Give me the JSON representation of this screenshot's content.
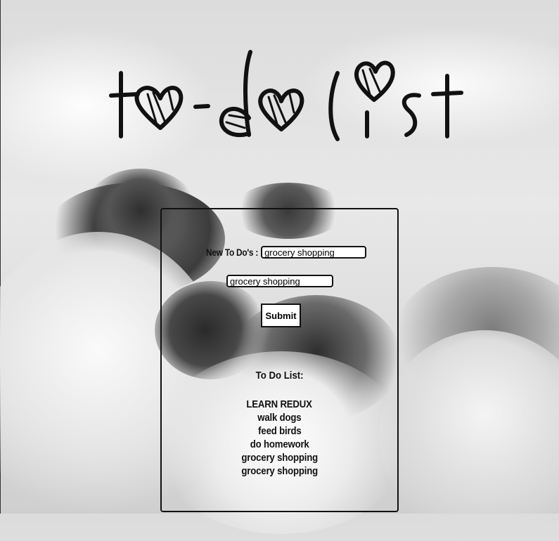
{
  "page": {
    "title_logo_text": "to-do list"
  },
  "form": {
    "new_label": "New To Do's :",
    "input_value": "grocery shopping",
    "echo_value": "grocery shopping",
    "submit_label": "Submit"
  },
  "list": {
    "heading": "To Do List:",
    "items": [
      "LEARN REDUX",
      "walk dogs",
      "feed birds",
      "do homework",
      "grocery shopping",
      "grocery shopping"
    ]
  },
  "colors": {
    "ink": "#111111",
    "sky": "#e0e0e0",
    "cloud_dark": "#3a3a3a"
  }
}
